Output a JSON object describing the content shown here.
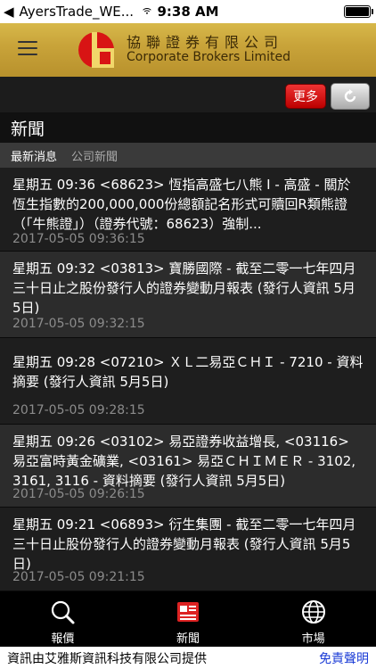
{
  "status_bar": {
    "carrier": "AyersTrade_WE...",
    "time": "9:38 AM"
  },
  "header": {
    "brand_cn": "協聯證券有限公司",
    "brand_en": "Corporate Brokers Limited"
  },
  "toolbar": {
    "more_label": "更多"
  },
  "page_title": "新聞",
  "tabs": [
    {
      "label": "最新消息",
      "active": true
    },
    {
      "label": "公司新聞",
      "active": false
    }
  ],
  "news": [
    {
      "headline": "星期五 09:36 <68623> 恆指高盛七八熊 I - 高盛 - 關於恆生指數的200,000,000份總額記名形式可贖回R類熊證（「牛熊證」）（證券代號：68623）強制...",
      "time": "2017-05-05 09:36:15"
    },
    {
      "headline": "星期五 09:32 <03813> 寶勝國際 - 截至二零一七年四月三十日止之股份發行人的證券變動月報表 (發行人資訊 5月5日)",
      "time": "2017-05-05 09:32:15"
    },
    {
      "headline": "星期五 09:28 <07210> ＸＬ二易亞ＣＨＩ - 7210 - 資料摘要 (發行人資訊 5月5日)",
      "time": "2017-05-05 09:28:15"
    },
    {
      "headline": "星期五 09:26 <03102> 易亞證券收益增長, <03116> 易亞富時黃金礦業, <03161> 易亞ＣＨＩＭＥＲ - 3102, 3161, 3116 - 資料摘要 (發行人資訊 5月5日)",
      "time": "2017-05-05 09:26:15"
    },
    {
      "headline": "星期五 09:21 <06893> 衍生集團 - 截至二零一七年四月三十日止股份發行人的證券變動月報表 (發行人資訊 5月5日)",
      "time": "2017-05-05 09:21:15"
    }
  ],
  "bottom_nav": [
    {
      "label": "報價",
      "icon": "search-icon"
    },
    {
      "label": "新聞",
      "icon": "news-icon",
      "active": true
    },
    {
      "label": "市場",
      "icon": "globe-icon"
    }
  ],
  "footer": {
    "provider": "資訊由艾雅斯資訊科技有限公司提供",
    "disclaimer": "免責聲明"
  },
  "colors": {
    "header_gold": "#c9a43a",
    "more_button_red": "#cc1111",
    "disclaimer_blue": "#1a3bd6",
    "news_icon_red": "#d22"
  }
}
